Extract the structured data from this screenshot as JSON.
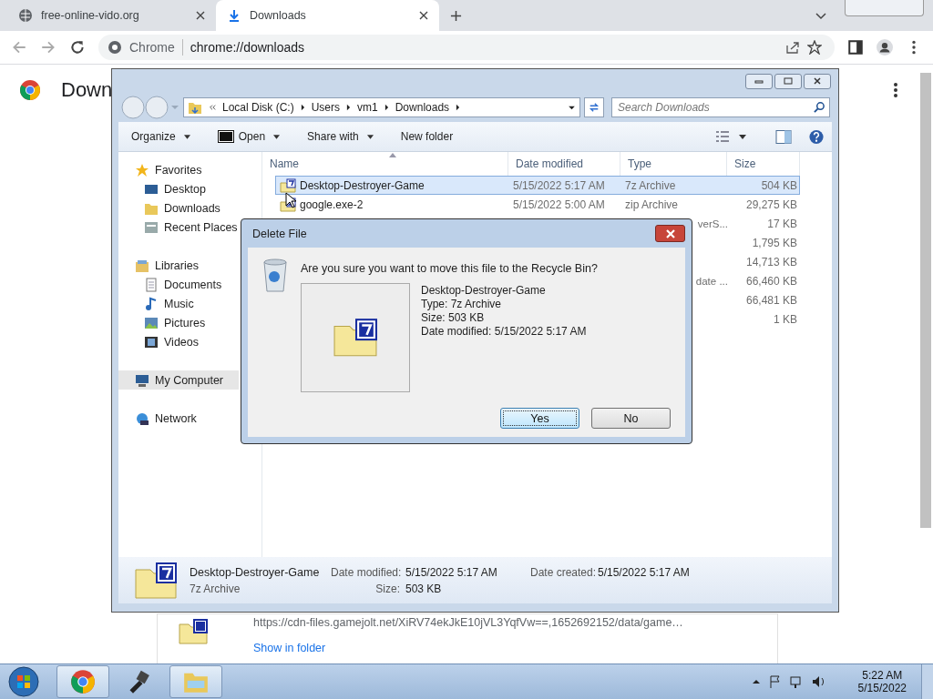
{
  "browser": {
    "tabs": [
      {
        "title": "free-online-vido.org",
        "selected": false
      },
      {
        "title": "Downloads",
        "selected": true
      }
    ],
    "address": {
      "chip": "Chrome",
      "url": "chrome://downloads"
    },
    "page_title": "Down",
    "download": {
      "url": "https://cdn-files.gamejolt.net/XiRV74ekJkE10jVL3YqfVw==,1652692152/data/game…",
      "link": "Show in folder"
    }
  },
  "explorer": {
    "path": [
      "Local Disk (C:)",
      "Users",
      "vm1",
      "Downloads"
    ],
    "search": {
      "placeholder": "Search Downloads"
    },
    "toolbar": [
      {
        "label": "Organize",
        "kind": "menu"
      },
      {
        "label": "Open",
        "kind": "app-menu"
      },
      {
        "label": "Share with",
        "kind": "menu"
      },
      {
        "label": "New folder",
        "kind": "button"
      }
    ],
    "nav": [
      {
        "label": "Favorites",
        "kind": "star",
        "selected": false,
        "children": [
          {
            "label": "Desktop",
            "kind": "desktop",
            "selected": false
          },
          {
            "label": "Downloads",
            "kind": "folder",
            "selected": false
          },
          {
            "label": "Recent Places",
            "kind": "recent",
            "selected": false
          }
        ]
      },
      {
        "label": "Libraries",
        "kind": "library",
        "selected": false,
        "children": [
          {
            "label": "Documents",
            "kind": "document",
            "selected": false
          },
          {
            "label": "Music",
            "kind": "music",
            "selected": false
          },
          {
            "label": "Pictures",
            "kind": "pictures",
            "selected": false
          },
          {
            "label": "Videos",
            "kind": "videos",
            "selected": false
          }
        ]
      },
      {
        "label": "My Computer",
        "kind": "computer",
        "selected": true
      },
      {
        "label": "Network",
        "kind": "network",
        "selected": false
      }
    ],
    "columns": [
      "Name",
      "Date modified",
      "Type",
      "Size"
    ],
    "rows": [
      {
        "name": "Desktop-Destroyer-Game",
        "date": "5/15/2022 5:17 AM",
        "type": "7z Archive",
        "size": "504 KB",
        "kind": "sevenzip",
        "selected": true
      },
      {
        "name": "google.exe-2",
        "date": "5/15/2022 5:00 AM",
        "type": "zip Archive",
        "size": "29,275 KB",
        "kind": "zip",
        "selected": false
      },
      {
        "type": "verS...",
        "size": "17 KB",
        "selected": false
      },
      {
        "size": "1,795 KB",
        "selected": false
      },
      {
        "size": "14,713 KB",
        "selected": false
      },
      {
        "type": "date ...",
        "size": "66,460 KB",
        "selected": false
      },
      {
        "size": "66,481 KB",
        "selected": false
      },
      {
        "size": "1 KB",
        "selected": false
      }
    ],
    "details": {
      "name": "Desktop-Destroyer-Game",
      "type": "7z Archive",
      "fields": [
        {
          "label": "Date modified:",
          "value": "5/15/2022 5:17 AM"
        },
        {
          "label": "Size:",
          "value": "503 KB"
        },
        {
          "label": "Date created:",
          "value": "5/15/2022 5:17 AM"
        }
      ]
    }
  },
  "dialog": {
    "title": "Delete File",
    "question": "Are you sure you want to move this file to the Recycle Bin?",
    "file": {
      "name": "Desktop-Destroyer-Game",
      "lines": [
        "Type: 7z Archive",
        "Size: 503 KB",
        "Date modified: 5/15/2022 5:17 AM"
      ]
    },
    "buttons": [
      {
        "label": "Yes",
        "selected": true
      },
      {
        "label": "No",
        "selected": false
      }
    ]
  },
  "taskbar": {
    "apps": [
      {
        "kind": "chrome",
        "open": true
      },
      {
        "kind": "tool",
        "open": false
      },
      {
        "kind": "explorer",
        "open": true
      }
    ],
    "time": "5:22 AM",
    "date": "5/15/2022"
  }
}
